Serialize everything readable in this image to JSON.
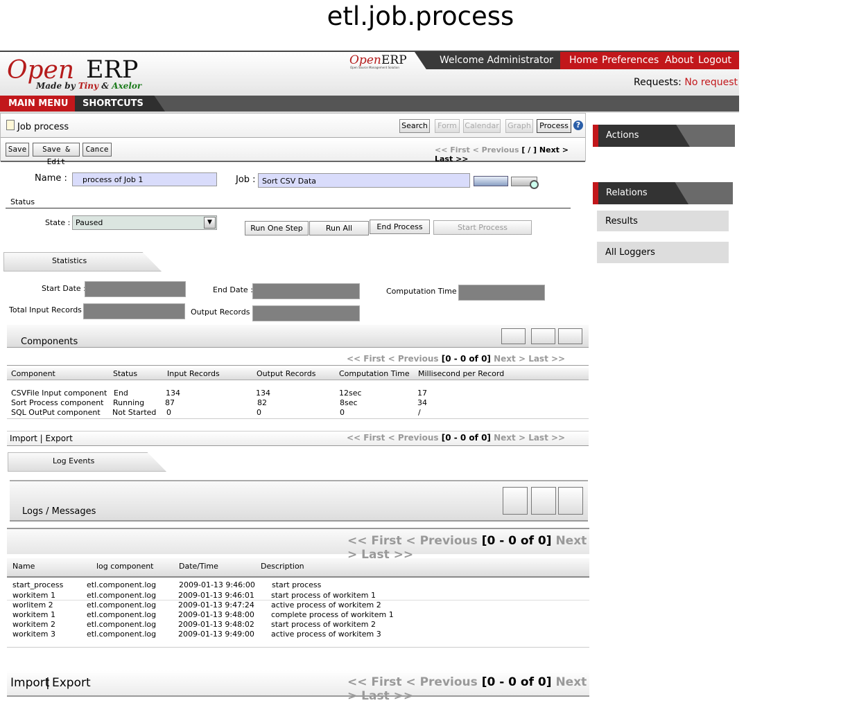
{
  "page_title": "etl.job.process",
  "header": {
    "logo_open": "Open",
    "logo_erp": "ERP",
    "logo_made_by": "Made by",
    "logo_tiny": "Tiny",
    "logo_amp": "&",
    "logo_axelor": "Axelor",
    "mini_logo_open": "Open",
    "mini_logo_erp": "ERP",
    "mini_logo_sub": "Open Source Management Solution",
    "welcome": "Welcome Administrator",
    "nav": [
      "Home",
      "Preferences",
      "About",
      "Logout"
    ],
    "requests_label": "Requests:",
    "requests_value": "No request",
    "main_menu": "MAIN MENU",
    "shortcuts": "SHORTCUTS"
  },
  "toolbar": {
    "title": "Job process",
    "views": [
      "Search",
      "Form",
      "Calendar",
      "Graph",
      "Process"
    ],
    "help": "?",
    "save": "Save",
    "save_edit": "Save & Edit",
    "cancel": "Cance",
    "pager": {
      "first": "<< First",
      "previous": "< Previous",
      "range": "[ / ]",
      "next": "Next >",
      "last": "Last >>"
    }
  },
  "sidebar": {
    "actions": "Actions",
    "relations": "Relations",
    "results": "Results",
    "all_loggers": "All Loggers"
  },
  "form": {
    "name_label": "Name :",
    "name_value": "process of Job 1",
    "job_label": "Job :",
    "job_value": "Sort CSV Data",
    "status_section": "Status",
    "state_label": "State :",
    "state_value": "Paused",
    "buttons": [
      "Run One Step",
      "Run All",
      "End Process",
      "Start Process"
    ]
  },
  "statistics": {
    "tab": "Statistics",
    "start_date": "Start Date :",
    "end_date": "End Date :",
    "computation_time": "Computation Time :",
    "total_input": "Total Input Records :",
    "output_records": "Output Records :"
  },
  "components": {
    "title": "Components",
    "pager": {
      "first": "<< First",
      "previous": "< Previous",
      "range": "[0 - 0 of 0]",
      "next": "Next >",
      "last": "Last >>"
    },
    "columns": [
      "Component",
      "Status",
      "Input Records",
      "Output Records",
      "Computation Time",
      "Millisecond per Record"
    ],
    "rows": [
      [
        "CSVFile Input component",
        "End",
        "134",
        "134",
        "12sec",
        "17"
      ],
      [
        "Sort Process component",
        "Running",
        "87",
        "82",
        "8sec",
        "34"
      ],
      [
        "SQL OutPut component",
        "Not Started",
        "0",
        "0",
        "0",
        "/"
      ]
    ],
    "import_export": "Import | Export"
  },
  "log_events": {
    "tab": "Log Events",
    "title": "Logs / Messages",
    "pager": {
      "first": "<< First",
      "previous": "< Previous",
      "range": "[0 - 0 of 0]",
      "next": "Next >",
      "last": "Last >>"
    },
    "columns": [
      "Name",
      "log component",
      "Date/Time",
      "Description"
    ],
    "rows": [
      [
        "start_process",
        "etl.component.log",
        "2009-01-13 9:46:00",
        "start process"
      ],
      [
        "workitem 1",
        "etl.component.log",
        "2009-01-13 9:46:01",
        "start process of workitem 1"
      ],
      [
        "worlitem 2",
        "etl.component.log",
        "2009-01-13 9:47:24",
        "active process of workitem 2"
      ],
      [
        "workitem 1",
        "etl.component.log",
        "2009-01-13 9:48:00",
        "complete process of workitem 1"
      ],
      [
        "workitem 2",
        "etl.component.log",
        "2009-01-13 9:48:02",
        "start process of workitem 2"
      ],
      [
        "workitem 3",
        "etl.component.log",
        "2009-01-13 9:49:00",
        "active process of workitem 3"
      ]
    ],
    "import": "Import",
    "sep": "|",
    "export": "Export"
  },
  "colors": {
    "brand_red": "#c2171b",
    "dark_bar": "#555555",
    "input_blue": "#d9dcfb"
  }
}
